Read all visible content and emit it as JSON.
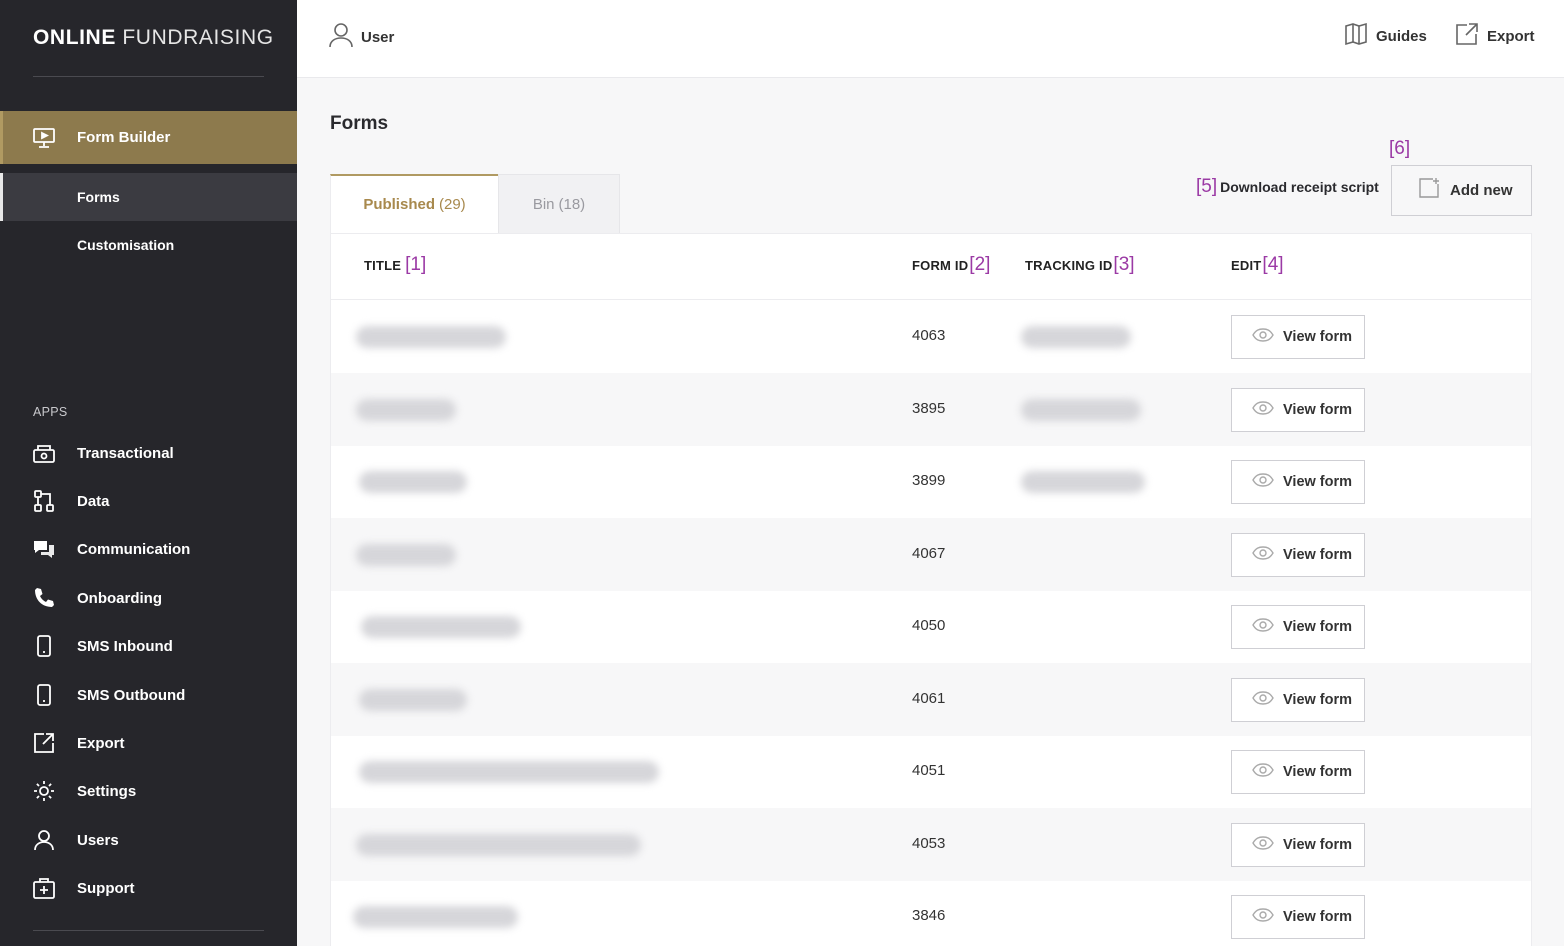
{
  "brand": {
    "bold": "ONLINE",
    "light": "FUNDRAISING"
  },
  "sidebar": {
    "form_builder": {
      "label": "Form Builder",
      "icon": "presentation-icon"
    },
    "sub_items": [
      {
        "label": "Forms"
      },
      {
        "label": "Customisation"
      }
    ],
    "apps_heading": "APPS",
    "apps": [
      {
        "label": "Transactional",
        "icon": "cash-register-icon"
      },
      {
        "label": "Data",
        "icon": "data-flow-icon"
      },
      {
        "label": "Communication",
        "icon": "chat-bubbles-icon"
      },
      {
        "label": "Onboarding",
        "icon": "phone-icon"
      },
      {
        "label": "SMS Inbound",
        "icon": "mobile-icon"
      },
      {
        "label": "SMS Outbound",
        "icon": "mobile-icon"
      },
      {
        "label": "Export",
        "icon": "external-link-icon"
      },
      {
        "label": "Settings",
        "icon": "gear-icon"
      },
      {
        "label": "Users",
        "icon": "user-icon"
      },
      {
        "label": "Support",
        "icon": "first-aid-icon"
      }
    ]
  },
  "topbar": {
    "user_label": "User",
    "guides_label": "Guides",
    "export_label": "Export"
  },
  "page": {
    "title": "Forms",
    "tabs": [
      {
        "label": "Published",
        "count": "(29)"
      },
      {
        "label": "Bin",
        "count": "(18)"
      }
    ],
    "download": {
      "annotation": "[5]",
      "label": "Download receipt script"
    },
    "add_new": {
      "annotation": "[6]",
      "label": "Add new"
    }
  },
  "table": {
    "columns": [
      {
        "label": "TITLE",
        "annotation": "[1]"
      },
      {
        "label": "FORM ID",
        "annotation": "[2]"
      },
      {
        "label": "TRACKING ID",
        "annotation": "[3]"
      },
      {
        "label": "EDIT",
        "annotation": "[4]"
      }
    ],
    "view_label": "View form",
    "rows": [
      {
        "form_id": "4063"
      },
      {
        "form_id": "3895"
      },
      {
        "form_id": "3899"
      },
      {
        "form_id": "4067"
      },
      {
        "form_id": "4050"
      },
      {
        "form_id": "4061"
      },
      {
        "form_id": "4051"
      },
      {
        "form_id": "4053"
      },
      {
        "form_id": "3846"
      }
    ]
  },
  "colors": {
    "sidebar_bg": "#26262b",
    "accent_gold": "#8d7a4d",
    "annotation_purple": "#9b3aa5"
  }
}
